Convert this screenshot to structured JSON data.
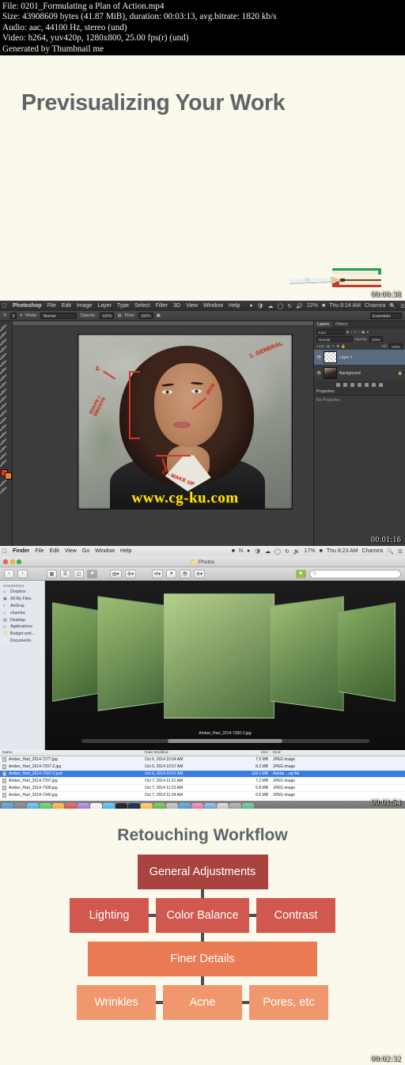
{
  "info_header": {
    "lines": [
      "File: 0201_Formulating a Plan of Action.mp4",
      "Size: 43908609 bytes (41.87 MiB), duration: 00:03:13, avg.bitrate: 1820 kb/s",
      "Audio: aac, 44100 Hz, stereo (und)",
      "Video: h264, yuv420p, 1280x800, 25.00 fps(r) (und)",
      "Generated by Thumbnail me"
    ]
  },
  "slide_previsualizing": {
    "title": "Previsualizing Your Work",
    "timestamp": "00:00:38",
    "background": "#fbf9ec",
    "title_color": "#5e6468"
  },
  "panel_photoshop": {
    "timestamp": "00:01:16",
    "menubar": {
      "apple": "apple-logo",
      "app": "Photoshop",
      "items": [
        "File",
        "Edit",
        "Image",
        "Layer",
        "Type",
        "Select",
        "Filter",
        "3D",
        "View",
        "Window",
        "Help"
      ],
      "battery": "22%",
      "clock": "Thu 8:14 AM",
      "user": "Chamira"
    },
    "options_bar": {
      "brush_size": "9",
      "mode_label": "Mode:",
      "mode_value": "Normal",
      "opacity_label": "Opacity:",
      "opacity_value": "100%",
      "flow_label": "Flow:",
      "flow_value": "100%",
      "workspace": "Essentials"
    },
    "annotations": [
      {
        "text": "1. GENERAL"
      },
      {
        "text": "2."
      },
      {
        "text": "SHAPE / SMOOTH"
      },
      {
        "text": "SKIN"
      },
      {
        "text": "3. - MAKE UP"
      }
    ],
    "watermark": "www.cg-ku.com",
    "layers_panel": {
      "tabs": [
        "Layers",
        "History"
      ],
      "active_tab": "Layers",
      "kind_filter": "Kind",
      "blend_mode": "Normal",
      "opacity_label": "Opacity:",
      "opacity_value": "100%",
      "lock_label": "Lock:",
      "fill_label": "Fill:",
      "fill_value": "100%",
      "layers": [
        {
          "name": "Layer 1",
          "selected": true,
          "locked": false
        },
        {
          "name": "Background",
          "selected": false,
          "locked": true
        }
      ]
    },
    "properties_panel": {
      "tab": "Properties",
      "empty_text": "No Properties"
    }
  },
  "panel_finder": {
    "timestamp": "00:01:54",
    "menubar": {
      "apple": "apple-logo",
      "app": "Finder",
      "items": [
        "File",
        "Edit",
        "View",
        "Go",
        "Window",
        "Help"
      ],
      "battery": "17%",
      "clock": "Thu 8:23 AM",
      "user": "Chamira"
    },
    "window_title": "Photos",
    "toolbar": {
      "back": "‹",
      "forward": "›",
      "view_icon": "icon-view",
      "view_list": "list-view",
      "view_column": "column-view",
      "view_coverflow": "coverflow-view",
      "arrange": "arrange-button",
      "action": "action-button",
      "share": "share-button",
      "tags": "tags-button",
      "search_placeholder": "Q"
    },
    "sidebar": {
      "header": "FAVORITES",
      "items": [
        {
          "label": "Dropbox",
          "icon": "dropbox-icon"
        },
        {
          "label": "All My Files",
          "icon": "all-files-icon"
        },
        {
          "label": "AirDrop",
          "icon": "airdrop-icon"
        },
        {
          "label": "chamira",
          "icon": "home-icon"
        },
        {
          "label": "Desktop",
          "icon": "desktop-icon"
        },
        {
          "label": "Applications",
          "icon": "applications-icon"
        },
        {
          "label": "Budget and...",
          "icon": "folder-icon"
        },
        {
          "label": "Documents",
          "icon": "documents-icon"
        }
      ]
    },
    "coverflow": {
      "current_file": "Amber_Hart_2014-7390-2.jpg"
    },
    "file_list": {
      "columns": [
        "Name",
        "Date Modified",
        "Size",
        "Kind"
      ],
      "rows": [
        {
          "name": "Amber_Hart_2014-7277.jpg",
          "date": "Oct 6, 2014 10:54 AM",
          "size": "7.5 MB",
          "kind": "JPEG image",
          "state": "alt"
        },
        {
          "name": "Amber_Hart_2014-7297-2.jpg",
          "date": "Oct 6, 2014 10:57 AM",
          "size": "8.3 MB",
          "kind": "JPEG image",
          "state": "alt"
        },
        {
          "name": "Amber_Hart_2014-7297-2.psd",
          "date": "Oct 6, 2014 10:57 AM",
          "size": "118.1 MB",
          "kind": "Adobe ...op file",
          "state": "sel"
        },
        {
          "name": "Amber_Hart_2014-7297.jpg",
          "date": "Oct 7, 2014 11:21 AM",
          "size": "7.2 MB",
          "kind": "JPEG image",
          "state": ""
        },
        {
          "name": "Amber_Hart_2014-7308.jpg",
          "date": "Oct 7, 2014 11:23 AM",
          "size": "6.8 MB",
          "kind": "JPEG image",
          "state": ""
        },
        {
          "name": "Amber_Hart_2014-7340.jpg",
          "date": "Oct 7, 2014 11:24 AM",
          "size": "6.6 MB",
          "kind": "JPEG image",
          "state": ""
        }
      ]
    }
  },
  "slide_workflow": {
    "title": "Retouching Workflow",
    "timestamp": "00:02:32",
    "colors": {
      "level1": "#a8433f",
      "level2": "#d0584e",
      "level3": "#ea7a53",
      "level4": "#f0976e",
      "connector": "#48505a",
      "background": "#fbf9ec",
      "title": "#5e6468"
    },
    "nodes": {
      "general_adjustments": "General Adjustments",
      "lighting": "Lighting",
      "color_balance": "Color Balance",
      "contrast": "Contrast",
      "finer_details": "Finer Details",
      "wrinkles": "Wrinkles",
      "acne": "Acne",
      "pores": "Pores, etc"
    }
  }
}
